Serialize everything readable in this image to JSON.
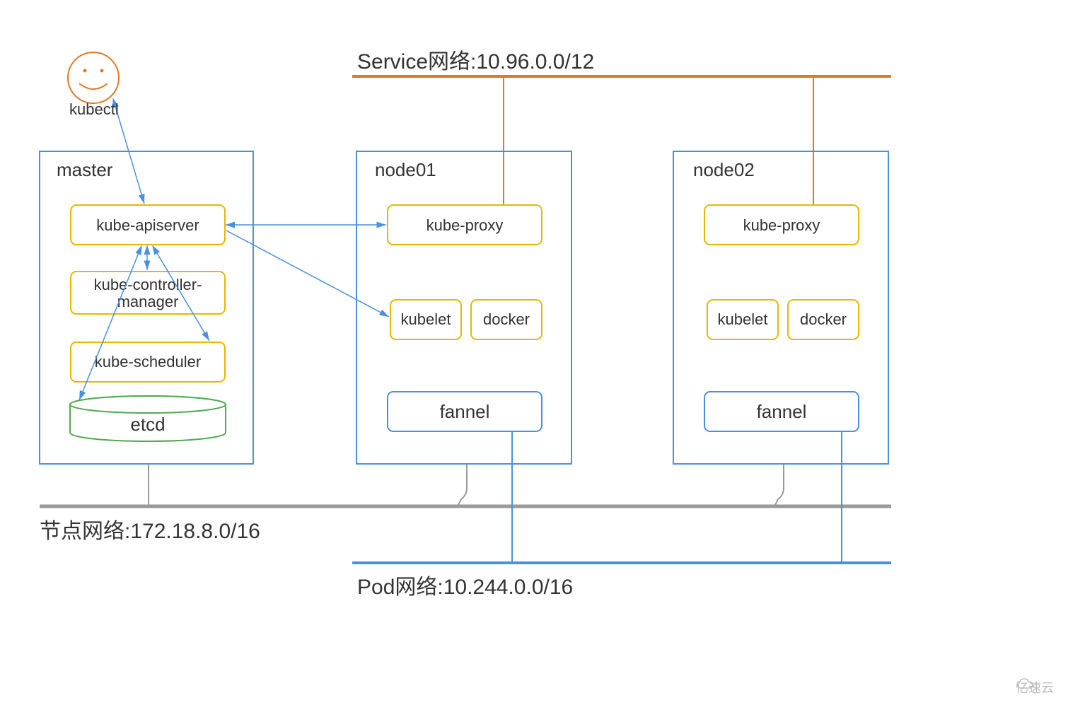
{
  "kubectl": {
    "label": "kubectl"
  },
  "networks": {
    "service": "Service网络:10.96.0.0/12",
    "node": "节点网络:172.18.8.0/16",
    "pod": "Pod网络:10.244.0.0/16"
  },
  "master": {
    "title": "master",
    "apiserver": "kube-apiserver",
    "controller_l1": "kube-controller-",
    "controller_l2": "manager",
    "scheduler": "kube-scheduler",
    "etcd": "etcd"
  },
  "node01": {
    "title": "node01",
    "proxy": "kube-proxy",
    "kubelet": "kubelet",
    "docker": "docker",
    "fannel": "fannel"
  },
  "node02": {
    "title": "node02",
    "proxy": "kube-proxy",
    "kubelet": "kubelet",
    "docker": "docker",
    "fannel": "fannel"
  },
  "watermark": "亿速云"
}
